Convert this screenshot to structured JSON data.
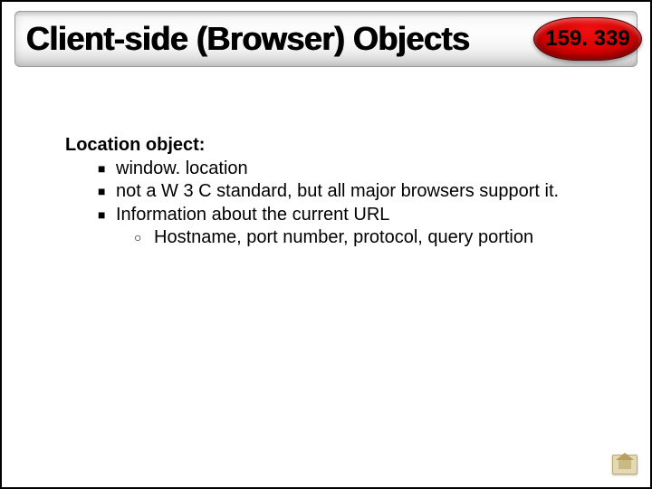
{
  "header": {
    "title": "Client-side (Browser) Objects",
    "badge": "159. 339"
  },
  "content": {
    "topic_title": "Location object:",
    "bullets": [
      "window. location",
      "not a W 3 C standard, but all major browsers support it.",
      "Information about the current URL"
    ],
    "sub_bullets": [
      "Hostname, port number, protocol, query portion"
    ]
  },
  "icons": {
    "corner": "home-icon"
  },
  "colors": {
    "badge_bg": "#d60000",
    "header_gradient_top": "#d6d6d6",
    "header_gradient_bottom": "#cfcfcf"
  }
}
